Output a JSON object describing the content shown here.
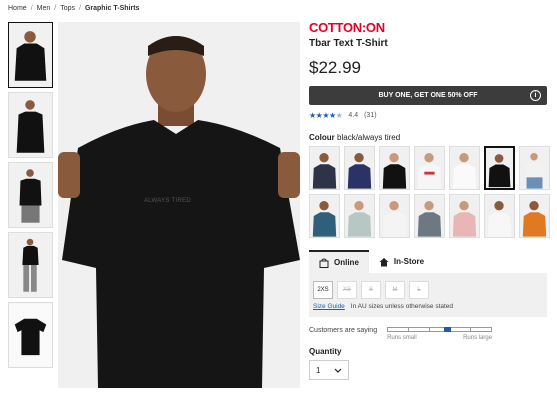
{
  "breadcrumb": {
    "items": [
      "Home",
      "Men",
      "Tops"
    ],
    "current": "Graphic T-Shirts"
  },
  "product": {
    "brand": "COTTON:ON",
    "title": "Tbar Text T-Shirt",
    "price": "$22.99",
    "shirt_print": "ALWAYS TIRED"
  },
  "promo": {
    "label": "BUY ONE, GET ONE 50% OFF",
    "info_icon": "i"
  },
  "rating": {
    "stars": "★★★★",
    "half": "★",
    "score": "4.4",
    "count": "(31)",
    "value": 4.4
  },
  "colour": {
    "label": "Colour",
    "selected": "black/always tired"
  },
  "shipping": {
    "tabs": [
      {
        "label": "Online"
      },
      {
        "label": "In-Store"
      }
    ]
  },
  "sizes": {
    "options": [
      {
        "label": "2XS",
        "available": true
      },
      {
        "label": "XS",
        "available": false
      },
      {
        "label": "S",
        "available": false
      },
      {
        "label": "M",
        "available": false
      },
      {
        "label": "L",
        "available": false
      }
    ],
    "guide_label": "Size Guide",
    "note": "In AU sizes unless otherwise stated"
  },
  "fit": {
    "label": "Customers are saying",
    "low_label": "Runs small",
    "high_label": "Runs large",
    "value": 0.58
  },
  "quantity": {
    "label": "Quantity",
    "value": "1"
  },
  "colors": {
    "brand_red": "#e4002b",
    "promo_bg": "#3c3c3c",
    "link_blue": "#1f5fa8"
  }
}
